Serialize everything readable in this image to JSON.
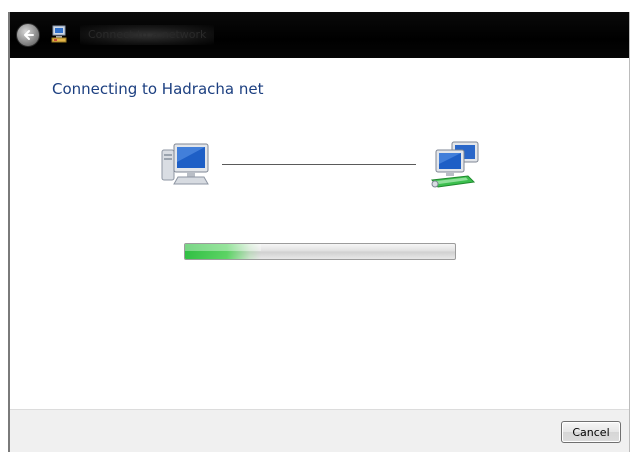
{
  "window": {
    "title": "Connect to a network",
    "back_icon": "back-arrow-icon",
    "app_icon": "network-connect-icon"
  },
  "main": {
    "heading": "Connecting to Hadracha net",
    "source_icon": "computer-icon",
    "target_icon": "network-icon"
  },
  "progress": {
    "fraction": 0.28,
    "accent_color": "#35c24a"
  },
  "footer": {
    "cancel_label": "Cancel"
  }
}
